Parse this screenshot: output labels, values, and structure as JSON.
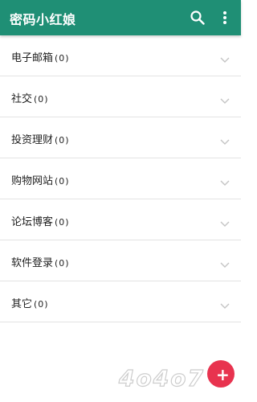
{
  "app": {
    "title": "密码小红娘",
    "accent_color": "#1f8f75",
    "actions": [
      {
        "name": "search-icon"
      },
      {
        "name": "more-vert-icon"
      }
    ]
  },
  "categories": [
    {
      "label": "电子邮箱",
      "count": "(0)"
    },
    {
      "label": "社交",
      "count": "(0)"
    },
    {
      "label": "投资理财",
      "count": "(0)"
    },
    {
      "label": "购物网站",
      "count": "(0)"
    },
    {
      "label": "论坛博客",
      "count": "(0)"
    },
    {
      "label": "软件登录",
      "count": "(0)"
    },
    {
      "label": "其它",
      "count": "(0)"
    }
  ],
  "watermark": {
    "text": "4o4o7",
    "badge_color": "#e8334f"
  }
}
